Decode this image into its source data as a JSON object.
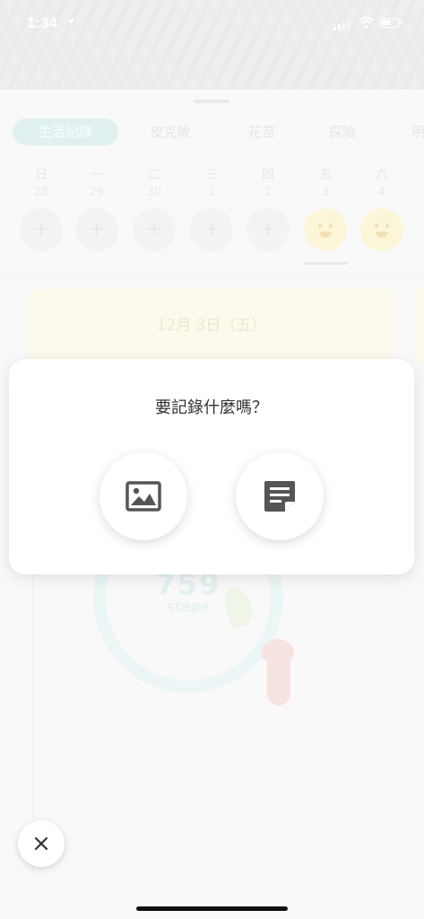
{
  "status_bar": {
    "time": "1:34"
  },
  "tabs": [
    "生活記錄",
    "皮克敏",
    "花苗",
    "探險",
    "明"
  ],
  "week": [
    {
      "dow": "日",
      "date": "28",
      "icon": "plus"
    },
    {
      "dow": "一",
      "date": "29",
      "icon": "plus"
    },
    {
      "dow": "二",
      "date": "30",
      "icon": "plus"
    },
    {
      "dow": "三",
      "date": "1",
      "icon": "plus"
    },
    {
      "dow": "四",
      "date": "2",
      "icon": "plus"
    },
    {
      "dow": "五",
      "date": "3",
      "icon": "smiley"
    },
    {
      "dow": "六",
      "date": "4",
      "icon": "smiley"
    }
  ],
  "plus_symbol": "+",
  "date_card": {
    "label": "12月 3日（五）"
  },
  "steps": {
    "value": "759",
    "unit": "steps"
  },
  "modal": {
    "title": "要記錄什麼嗎？",
    "photo_icon": "image-icon",
    "note_icon": "note-icon"
  },
  "close_symbol": "×",
  "colors": {
    "accent_teal": "#cfe9ea",
    "smiley_yellow": "#fbf1c2",
    "modal_bg": "#ffffff",
    "icon_gray": "#555555"
  }
}
